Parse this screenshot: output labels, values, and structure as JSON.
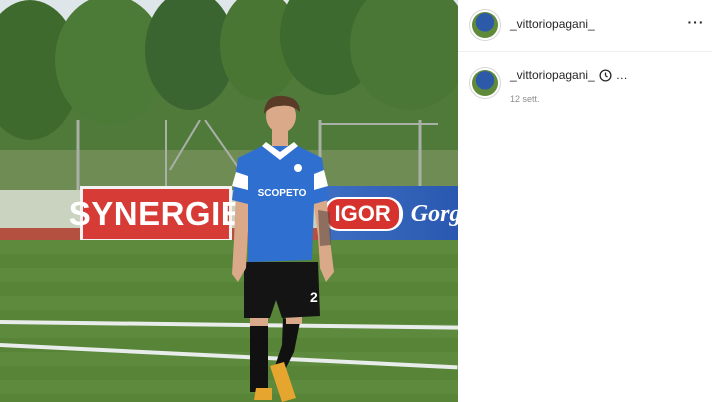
{
  "post": {
    "banners": {
      "red_sponsor": "SYNERGIE",
      "blue_sponsor_1": "IGOR",
      "blue_sponsor_2": "Gorg"
    },
    "shirt_sponsor": "SCOPETO",
    "shirt_number": "2"
  },
  "header": {
    "username": "_vittoriopagani_",
    "more_label": "···"
  },
  "caption": {
    "username": "_vittoriopagani_",
    "trailing": "…",
    "date": "12 sett."
  },
  "colors": {
    "shirt_blue": "#2f6fd0",
    "banner_red": "#d63b35",
    "pitch_green": "#5d8a3c",
    "meta_gray": "#8e8e8e"
  }
}
